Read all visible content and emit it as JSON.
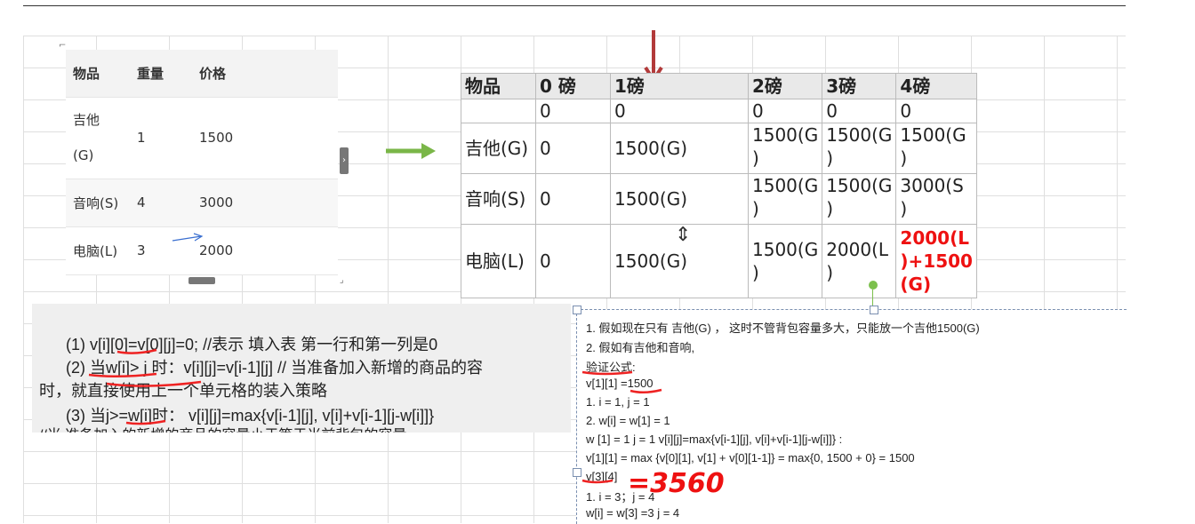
{
  "left_table": {
    "headers": [
      "物品",
      "重量",
      "价格"
    ],
    "rows": [
      {
        "item": "吉他\n(G)",
        "item_line1": "吉他",
        "item_line2": "(G)",
        "weight": "1",
        "price": "1500"
      },
      {
        "item": "音响(S)",
        "weight": "4",
        "price": "3000"
      },
      {
        "item": "电脑(L)",
        "weight": "3",
        "price": "2000"
      }
    ]
  },
  "dp_table": {
    "headers": [
      "物品",
      "0 磅",
      "1磅",
      "2磅",
      "3磅",
      "4磅"
    ],
    "zero_row": [
      "",
      "0",
      "0",
      "0",
      "0",
      "0"
    ],
    "rows": [
      {
        "item": "吉他(G)",
        "cells": [
          "0",
          "1500(G)",
          "1500(G\n)",
          "1500(G\n)",
          "1500(G\n)"
        ]
      },
      {
        "item": "音响(S)",
        "cells": [
          "0",
          "1500(G)",
          "1500(G\n)",
          "1500(G\n)",
          "3000(S\n)"
        ]
      },
      {
        "item": "电脑(L)",
        "cells": [
          "0",
          "1500(G)",
          "1500(G\n)",
          "2000(L\n)",
          "2000(L\n)+1500\n(G)"
        ]
      }
    ],
    "highlight_color": "#e11111"
  },
  "rules_text": {
    "line1": "(1)  v[i][0]=v[0][j]=0; //表示 填入表 第一行和第一列是0",
    "line2": "(2) 当w[i]> j 时：v[i][j]=v[i-1][j]  // 当准备加入新增的商品的容",
    "line3": "时，就直接使用上一个单元格的装入策略",
    "line4": "(3) 当j>=w[i]时：  v[i][j]=max{v[i-1][j], v[i]+v[i-1][j-w[i]]}",
    "line5": "//当 准备加入的新增的商品的容量小于等于当前背包的容量"
  },
  "notes": {
    "lines": [
      "1. 假如现在只有 吉他(G) ，  这时不管背包容量多大，只能放一个吉他1500(G)",
      "2. 假如有吉他和音响,",
      "验证公式:",
      "v[1][1] =1500",
      "1. i = 1, j = 1",
      "2. w[i] = w[1] = 1",
      "w [1] = 1  j = 1   v[i][j]=max{v[i-1][j], v[i]+v[i-1][j-w[i]]} :",
      "v[1][1] = max {v[0][1], v[1] + v[0][1-1]} = max{0, 1500 + 0} = 1500",
      "v[3][4]",
      "1. i = 3；j = 4",
      "w[i] = w[3] =3 j = 4"
    ],
    "handwritten": "=3560"
  }
}
